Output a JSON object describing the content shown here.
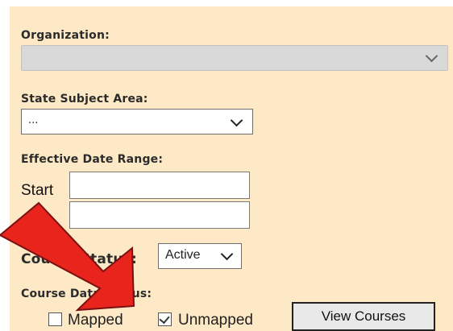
{
  "organization": {
    "label": "Organization:",
    "value": ""
  },
  "subject_area": {
    "label": "State Subject Area:",
    "value": "..."
  },
  "date_range": {
    "label": "Effective Date Range:",
    "start_label": "Start",
    "end_label": "",
    "start_value": "",
    "end_value": ""
  },
  "course_status": {
    "label": "Course Status:",
    "value": "Active"
  },
  "course_data_status": {
    "label": "Course Data Status:",
    "options": [
      {
        "label": "Mapped",
        "checked": false
      },
      {
        "label": "Unmapped",
        "checked": true
      }
    ]
  },
  "view_courses_label": "View Courses",
  "annotation": {
    "arrow_color": "#e8241c"
  }
}
